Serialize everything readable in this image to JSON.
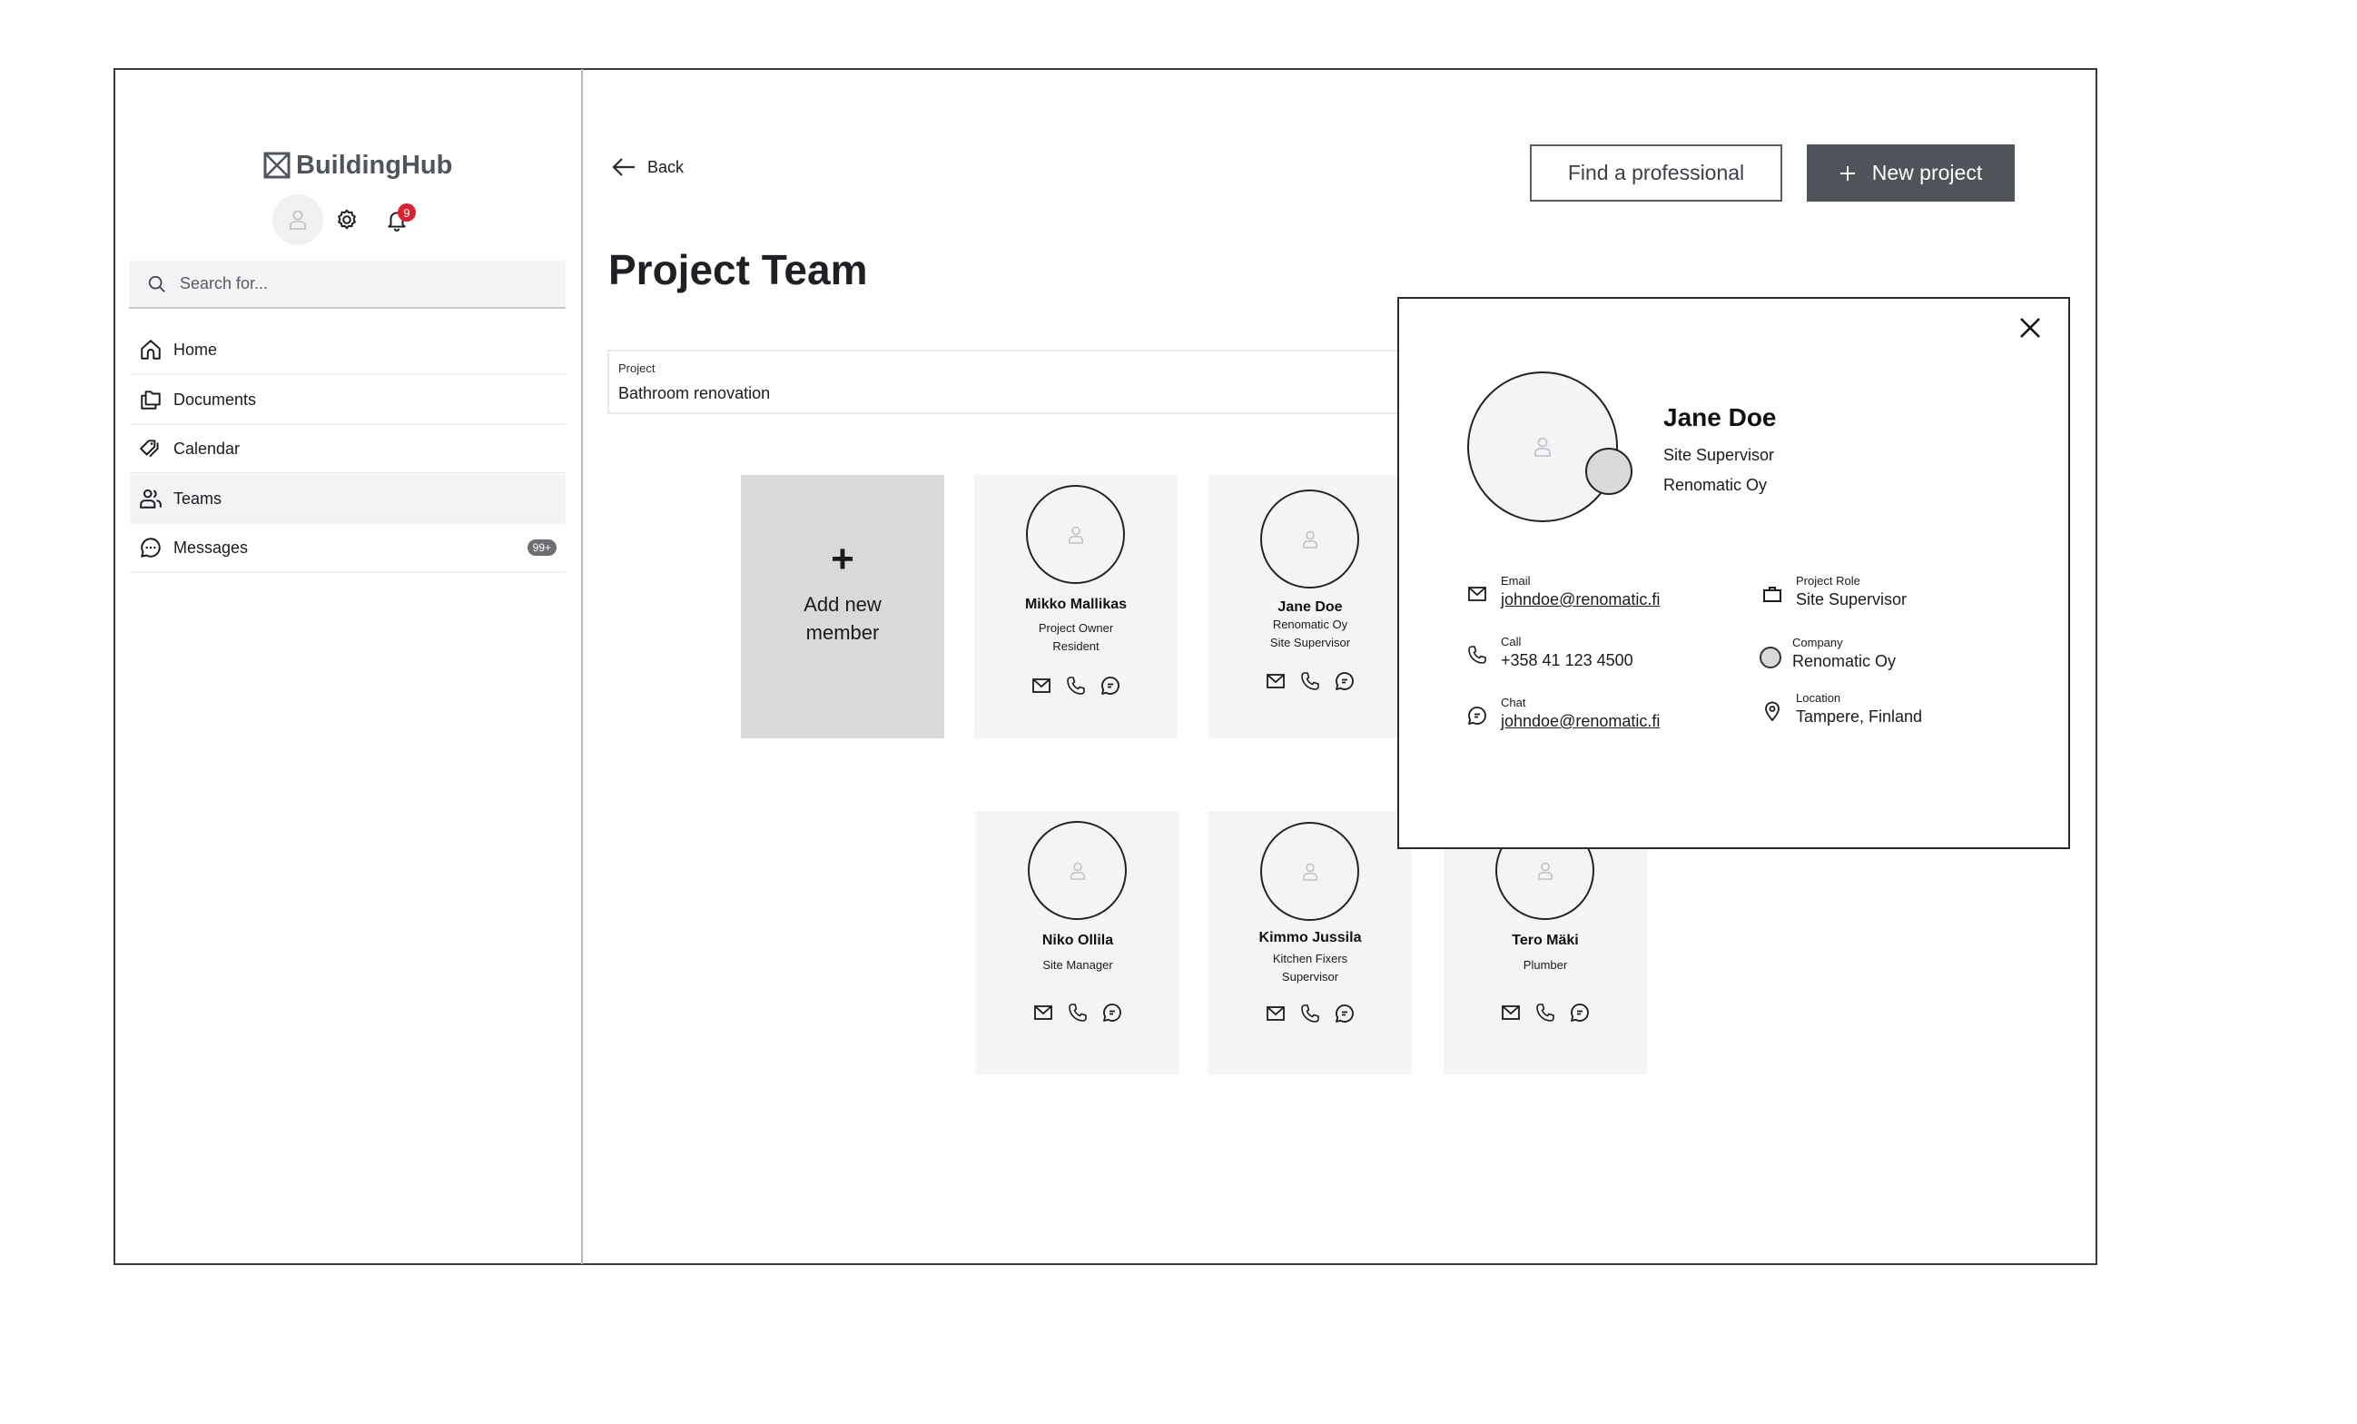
{
  "app": {
    "brand": "BuildingHub",
    "notifications_count": "9"
  },
  "sidebar": {
    "search_placeholder": "Search for...",
    "items": [
      {
        "label": "Home",
        "icon": "home-icon"
      },
      {
        "label": "Documents",
        "icon": "documents-icon"
      },
      {
        "label": "Calendar",
        "icon": "calendar-icon"
      },
      {
        "label": "Teams",
        "icon": "teams-icon",
        "active": true
      },
      {
        "label": "Messages",
        "icon": "messages-icon",
        "badge": "99+"
      }
    ]
  },
  "header": {
    "back_label": "Back",
    "find_professional_label": "Find a professional",
    "new_project_label": "New project"
  },
  "page": {
    "title": "Project Team",
    "project_select": {
      "label": "Project",
      "value": "Bathroom renovation"
    }
  },
  "team": {
    "add_label": "Add new member",
    "members": [
      {
        "name": "Mikko Mallikas",
        "lines": [
          "Project Owner",
          "Resident"
        ]
      },
      {
        "name": "Jane Doe",
        "lines": [
          "Renomatic Oy",
          "Site Supervisor"
        ]
      },
      {
        "name": "Niko Ollila",
        "lines": [
          "Site Manager"
        ]
      },
      {
        "name": "Kimmo Jussila",
        "lines": [
          "Kitchen Fixers",
          "Supervisor"
        ]
      },
      {
        "name": "Tero Mäki",
        "lines": [
          "Plumber"
        ]
      }
    ]
  },
  "profile_popup": {
    "name": "Jane Doe",
    "role": "Site Supervisor",
    "company": "Renomatic Oy",
    "details": {
      "email_label": "Email",
      "email": "johndoe@renomatic.fi",
      "call_label": "Call",
      "phone": "+358 41 123 4500",
      "chat_label": "Chat",
      "chat": "johndoe@renomatic.fi",
      "role_label": "Project Role",
      "role": "Site Supervisor",
      "company_label": "Company",
      "company": "Renomatic Oy",
      "location_label": "Location",
      "location": "Tampere, Finland"
    }
  },
  "colors": {
    "primary_button": "#50545a",
    "notification_badge": "#d92230",
    "add_card": "#d9d9d9",
    "card": "#f4f4f5"
  }
}
